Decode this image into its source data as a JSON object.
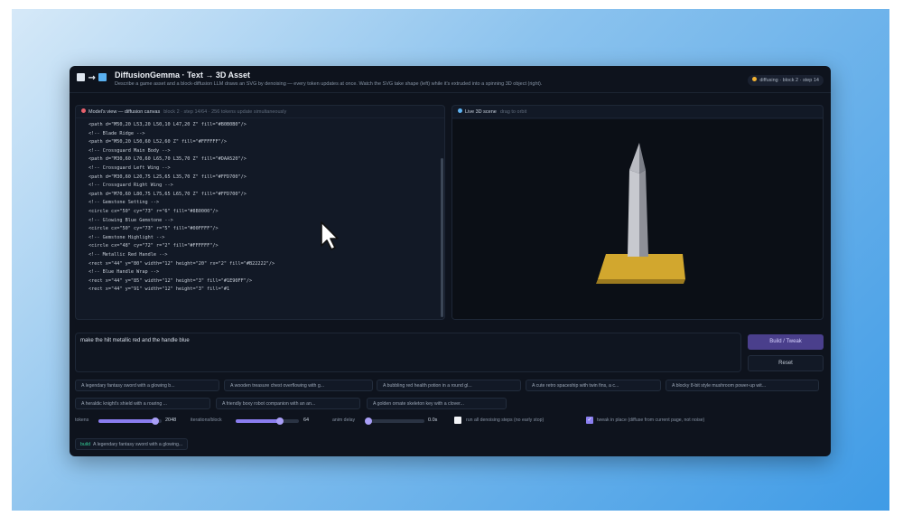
{
  "app": {
    "title": "DiffusionGemma · Text → 3D Asset",
    "subtitle": "Describe a game asset and a block-diffusion LLM draws an SVG by denoising — every token updates at once. Watch the SVG take shape (left) while it's extruded into a spinning 3D object (right).",
    "status": "diffusing · block 2 · step 14"
  },
  "left_panel": {
    "title": "Model's view — diffusion canvas",
    "meta": "block 2 · step 14/64 · 256 tokens update simultaneously",
    "icon_color": "#e8616c",
    "code_lines": [
      "<path d=\"M50,20 L53,20 L50,10 L47,20 Z\" fill=\"#B0B0B0\"/>",
      "<!-- Blade Ridge -->",
      "<path d=\"M50,20 L50,60 L52,60 Z\" fill=\"#FFFFFF\"/>",
      "<!-- Crossguard Main Body -->",
      "<path d=\"M30,60 L70,60 L65,70 L35,70 Z\" fill=\"#DAA520\"/>",
      "<!-- Crossguard Left Wing -->",
      "<path d=\"M30,60 L20,75 L25,65 L35,70 Z\" fill=\"#FFD700\"/>",
      "<!-- Crossguard Right Wing -->",
      "<path d=\"M70,60 L80,75 L75,65 L65,70 Z\" fill=\"#FFD700\"/>",
      "<!-- Gemstone Setting -->",
      "<circle cx=\"50\" cy=\"73\" r=\"6\" fill=\"#8B0000\"/>",
      "<!-- Glowing Blue Gemstone -->",
      "<circle cx=\"50\" cy=\"73\" r=\"5\" fill=\"#00FFFF\"/>",
      "<!-- Gemstone Highlight -->",
      "<circle cx=\"48\" cy=\"72\" r=\"2\" fill=\"#FFFFFF\"/>",
      "<!-- Metallic Red Handle -->",
      "<rect x=\"44\" y=\"80\" width=\"12\" height=\"20\" rx=\"2\" fill=\"#B22222\"/>",
      "<!-- Blue Handle Wrap -->",
      "<rect x=\"44\" y=\"85\" width=\"12\" height=\"3\" fill=\"#1E90FF\"/>",
      "<rect x=\"44\" y=\"91\" width=\"12\" height=\"3\" fill=\"#1"
    ]
  },
  "right_panel": {
    "title": "Live 3D scene",
    "meta": "drag to orbit",
    "icon_color": "#5fb3f2"
  },
  "prompt": {
    "value": "make the hilt metallic red and the handle blue"
  },
  "buttons": {
    "build": "Build / Tweak",
    "reset": "Reset"
  },
  "examples": [
    "A legendary fantasy sword with a glowing b...",
    "A wooden treasure chest overflowing with g...",
    "A bubbling red health potion in a round gl...",
    "A cute retro spaceship with twin fins, a c...",
    "A blocky 8-bit style mushroom power-up wit...",
    "A heraldic knight's shield with a roaring ...",
    "A friendly boxy robot companion with an an...",
    "A golden ornate skeleton key with a clover..."
  ],
  "controls": {
    "tokens_label": "tokens",
    "tokens_value": "2048",
    "tokens_fraction": 0.9,
    "iterations_label": "iterations/block",
    "iterations_value": "64",
    "iterations_fraction": 0.7,
    "anim_label": "anim delay",
    "anim_value": "0.0s",
    "anim_fraction": 0.05,
    "run_all_label": "run all denoising steps (no early stop)",
    "run_all_checked": false,
    "tweak_label": "tweak in place (diffuse from current page, not noise)",
    "tweak_checked": true
  },
  "history": {
    "tag": "build",
    "text": "A legendary fantasy sword with a glowing..."
  },
  "colors": {
    "accent": "#8b7ff0",
    "build_button": "#4a3f8c",
    "blade": "#c7c9cf",
    "hilt": "#d2a72e",
    "status_dot": "#f2b232"
  }
}
